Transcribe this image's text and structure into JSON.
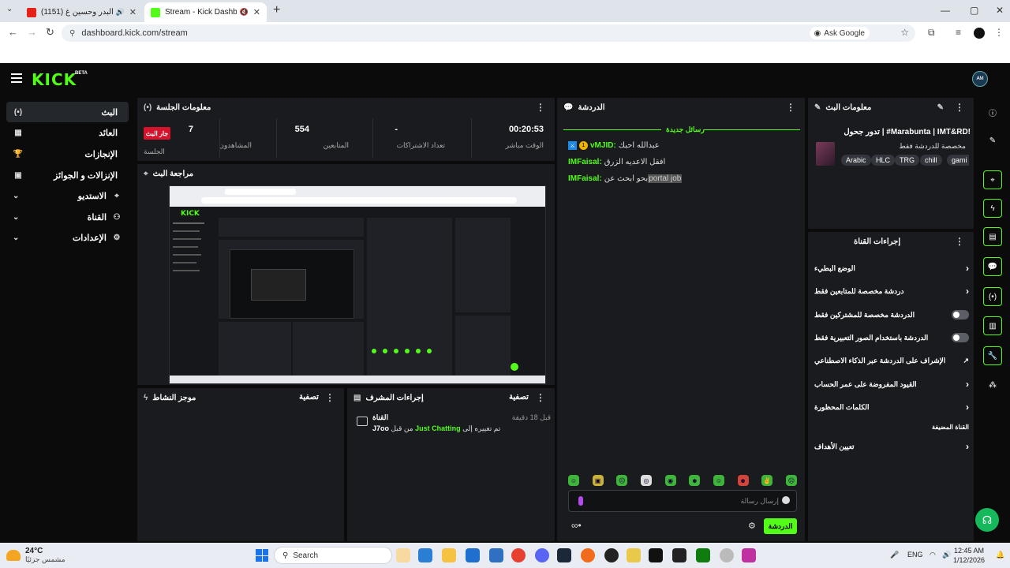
{
  "browser": {
    "tab_inactive_title": "(1151) نصرت البدر وحسين غ...",
    "tab_active_title": "Stream - Kick Dashboard",
    "url": "dashboard.kick.com/stream",
    "ask_google": "Ask Google"
  },
  "kick": {
    "logo": "KICK",
    "beta": "BETA",
    "avatar": "ᴬᴹ"
  },
  "nav": {
    "items": [
      {
        "label": "البث",
        "icon": "(•)"
      },
      {
        "label": "العائد",
        "icon": "▦"
      },
      {
        "label": "الإنجازات",
        "icon": "🏆"
      },
      {
        "label": "الإنزالات و الجوائز",
        "icon": "▣"
      },
      {
        "label": "الاستديو",
        "icon": "⌖",
        "chev": "⌄"
      },
      {
        "label": "القناة",
        "icon": "⚇",
        "chev": "⌄"
      },
      {
        "label": "الإعدادات",
        "icon": "⚙",
        "chev": "⌄"
      }
    ]
  },
  "session": {
    "title": "معلومات الجلسة",
    "stats": [
      {
        "value": "00:20:53",
        "label": "الوقت مباشر"
      },
      {
        "value": "-",
        "label": "تعداد الاشتراكات"
      },
      {
        "value": "554",
        "label": "المتابعين"
      },
      {
        "value": "7",
        "label": "المشاهدون"
      }
    ],
    "live_badge": "جار البث",
    "live_label": "الجلسة"
  },
  "preview": {
    "title": "مراجعة البث"
  },
  "chat": {
    "title": "الدردشة",
    "new_messages": "رسائل جديدة",
    "messages": [
      {
        "user": "vMJID:",
        "text": "عبدالله احبك"
      },
      {
        "user": "IMFaisal:",
        "text": "افقل الاعديه الزرق"
      },
      {
        "user": "IMFaisal:",
        "text": "بحو ابحث عن",
        "highlight": "portal job"
      }
    ],
    "input_placeholder": "إرسال رسالة",
    "send": "الدردشة"
  },
  "stream_info": {
    "title": "معلومات البث",
    "stream_title": "تدور جحول | #Marabunta | IMT&RD!",
    "subtitle": "مخصصة للدردشة فقط",
    "tags": [
      "Arabic",
      "HLC",
      "TRG",
      "chill",
      "gami"
    ]
  },
  "channel_actions": {
    "title": "إجراءات القناة",
    "rows": [
      {
        "label": "الوضع البطيء",
        "kind": "chevron"
      },
      {
        "label": "دردشة مخصصة للمتابعين فقط",
        "kind": "chevron"
      },
      {
        "label": "الدردشة مخصصة للمشتركين فقط",
        "kind": "toggle"
      },
      {
        "label": "الدردشة باستخدام الصور التعبيرية فقط",
        "kind": "toggle"
      },
      {
        "label": "الإشراف على الدردشة عبر الذكاء الاصطناعي",
        "kind": "external"
      },
      {
        "label": "القيود المفروضة على عمر الحساب",
        "kind": "chevron"
      },
      {
        "label": "الكلمات المحظورة",
        "kind": "chevron"
      },
      {
        "label": "القناة المضيفة",
        "kind": "none"
      },
      {
        "label": "تعيين الأهداف",
        "kind": "chevron"
      }
    ]
  },
  "activity": {
    "title": "موجز النشاط",
    "filter": "تصفية"
  },
  "mod_actions": {
    "title": "إجراءات المشرف",
    "filter": "تصفية",
    "item_title": "القناة",
    "item_user": "J7oo",
    "item_middle": "من قبل",
    "item_category": "Just Chatting",
    "item_suffix": "تم تغييره إلى",
    "item_time": "قبل 18 دقيقة"
  },
  "taskbar": {
    "temp": "24°C",
    "condition": "مشمس جزئيًا",
    "search": "Search",
    "lang": "ENG",
    "time": "12:45 AM",
    "date": "1/12/2026"
  },
  "colors": {
    "accent": "#53fc18",
    "panel": "#191b1f",
    "live": "#d4142c"
  }
}
